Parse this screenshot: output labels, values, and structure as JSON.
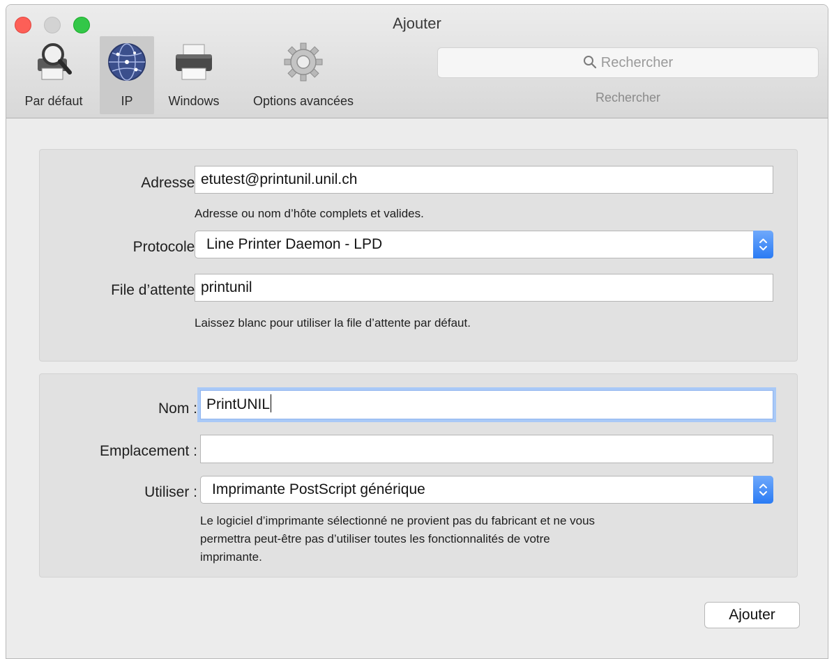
{
  "window": {
    "title": "Ajouter"
  },
  "toolbar": {
    "items": [
      {
        "label": "Par défaut",
        "icon": "default-printer-magnifier-icon"
      },
      {
        "label": "IP",
        "icon": "globe-icon",
        "selected": true
      },
      {
        "label": "Windows",
        "icon": "printer-icon"
      },
      {
        "label": "Options avancées",
        "icon": "gear-icon"
      }
    ],
    "search": {
      "placeholder": "Rechercher",
      "label": "Rechercher"
    }
  },
  "connection": {
    "address_label": "Adresse :",
    "address_value": "etutest@printunil.unil.ch",
    "address_hint": "Adresse ou nom d’hôte complets et valides.",
    "protocol_label": "Protocole :",
    "protocol_value": "Line Printer Daemon - LPD",
    "queue_label": "File d’attente :",
    "queue_value": "printunil",
    "queue_hint": "Laissez blanc pour utiliser la file d’attente par défaut."
  },
  "printer": {
    "name_label": "Nom :",
    "name_value": "PrintUNIL",
    "location_label": "Emplacement :",
    "location_value": "",
    "use_label": "Utiliser :",
    "use_value": "Imprimante PostScript générique",
    "warning_line1": "Le logiciel d’imprimante sélectionné ne provient pas du fabricant et ne vous",
    "warning_line2": "permettra peut-être pas d’utiliser toutes les fonctionnalités de votre",
    "warning_line3": "imprimante."
  },
  "actions": {
    "add_label": "Ajouter"
  },
  "colors": {
    "accent": "#2a7bf4",
    "focus_ring": "#a9c9f7",
    "close": "#fd5f57",
    "maximize": "#33c748"
  }
}
